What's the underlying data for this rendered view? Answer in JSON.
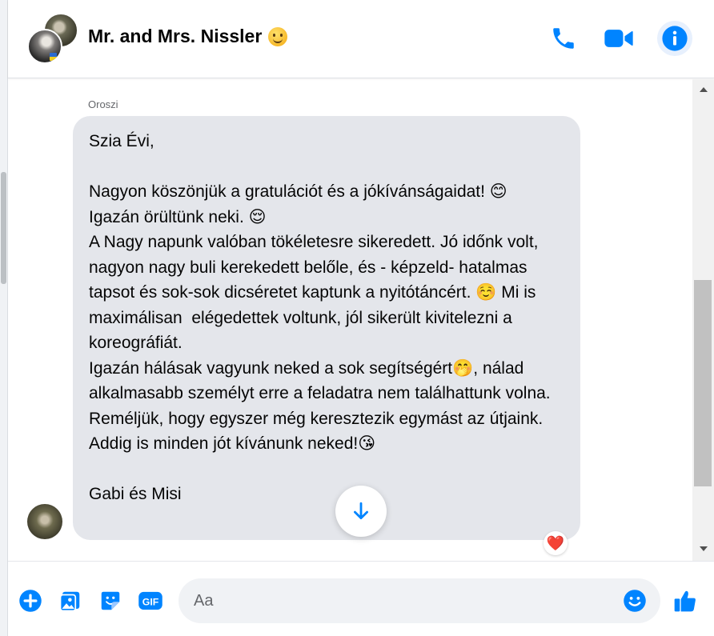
{
  "header": {
    "title": "Mr. and Mrs. Nissler",
    "title_emoji": "slightly-smiling-face",
    "actions": [
      "phone-icon",
      "video-camera-icon",
      "info-icon"
    ]
  },
  "conversation": {
    "sender_name": "Oroszi",
    "message": "Szia Évi,\n\nNagyon köszönjük a gratulációt és a jókívánságaidat! 😊\nIgazán örültünk neki. 😌\nA Nagy napunk valóban tökéletesre sikeredett. Jó időnk volt, nagyon nagy buli kerekedett belőle, és - képzeld- hatalmas tapsot és sok-sok dicséretet kaptunk a nyitótáncért. ☺️ Mi is maximálisan  elégedettek voltunk, jól sikerült kivitelezni a koreográfiát.\nIgazán hálásak vagyunk neked a sok segítségért🤭, nálad alkalmasabb személyt erre a feladatra nem találhattunk volna.\nReméljük, hogy egyszer még keresztezik egymást az útjaink. Addig is minden jót kívánunk neked!😘\n\nGabi és Misi",
    "reaction": "❤️"
  },
  "composer": {
    "placeholder": "Aa",
    "value": "",
    "icons": [
      "plus-icon",
      "photo-icon",
      "sticker-icon",
      "gif-icon",
      "emoji-icon",
      "thumbs-up-icon"
    ],
    "gif_label": "GIF"
  },
  "colors": {
    "accent": "#0084ff",
    "bubble": "#e4e6eb",
    "reaction": "#f0284a"
  }
}
